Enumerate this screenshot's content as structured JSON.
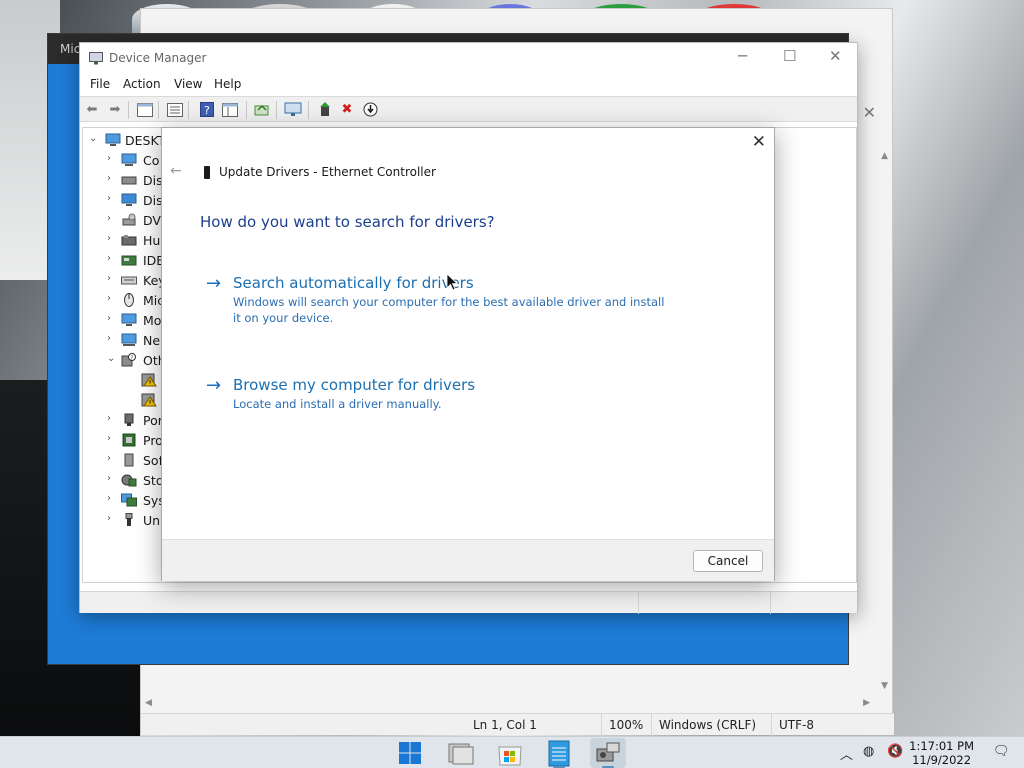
{
  "device_manager": {
    "title": "Device Manager",
    "menu": [
      "File",
      "Action",
      "View",
      "Help"
    ],
    "tree": {
      "root": "DESKTO",
      "items": [
        "Co",
        "Dis",
        "Dis",
        "DV",
        "Hu",
        "IDE",
        "Key",
        "Mic",
        "Mo",
        "Ne",
        "Oth",
        "Por",
        "Pro",
        "Sof",
        "Sto",
        "Sys",
        "Uni"
      ]
    }
  },
  "background_window": {
    "title": "Mic"
  },
  "dialog": {
    "title": "Update Drivers - Ethernet Controller",
    "question": "How do you want to search for drivers?",
    "options": [
      {
        "title": "Search automatically for drivers",
        "description": "Windows will search your computer for the best available driver and install it on your device."
      },
      {
        "title": "Browse my computer for drivers",
        "description": "Locate and install a driver manually."
      }
    ],
    "cancel_label": "Cancel"
  },
  "notepad": {
    "status": {
      "position": "Ln 1, Col 1",
      "zoom": "100%",
      "line_ending": "Windows (CRLF)",
      "encoding": "UTF-8"
    }
  },
  "taskbar": {
    "time": "1:17:01 PM",
    "date": "11/9/2022"
  },
  "colors": {
    "accent_blue": "#1e7bd6",
    "link_blue": "#1d6fb0",
    "warning_yellow": "#f2c200",
    "delete_red": "#d01f1f"
  }
}
